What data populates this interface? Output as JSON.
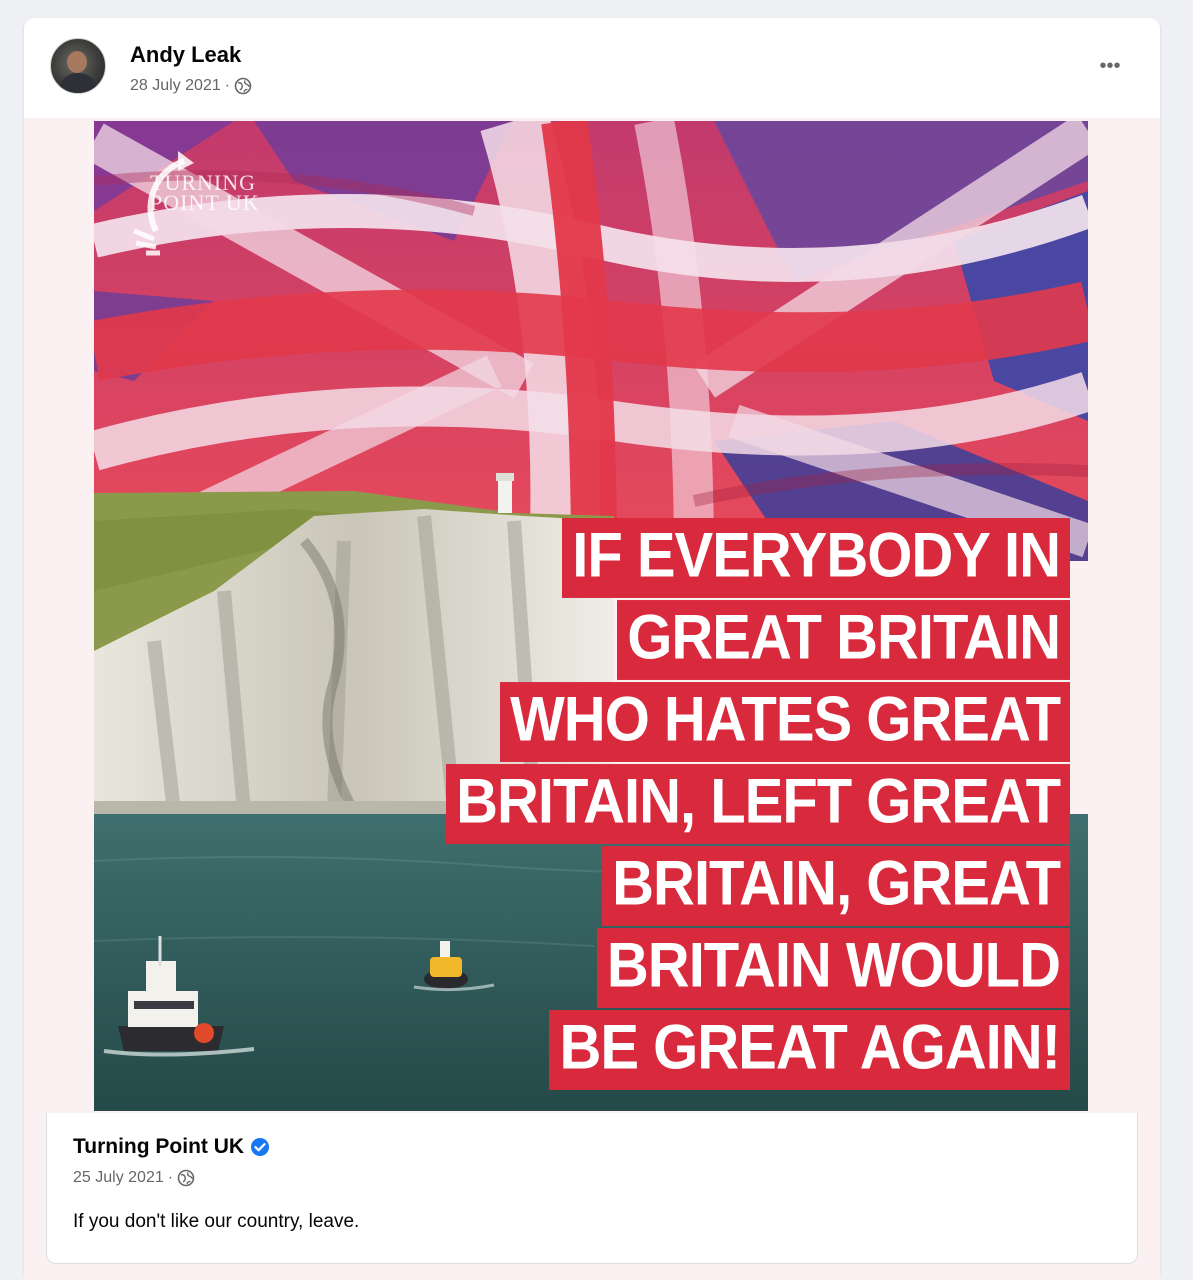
{
  "post": {
    "author": "Andy Leak",
    "date": "28 July 2021",
    "separator": "·",
    "privacy_icon": "globe-icon",
    "more_label": "•••"
  },
  "shared_post": {
    "author": "Turning Point UK",
    "verified_icon": "verified-badge-icon",
    "date": "25 July 2021",
    "separator": "·",
    "privacy_icon": "globe-icon",
    "caption": "If you don't like our country, leave.",
    "image": {
      "logo_lines": [
        "TURNING",
        "POINT UK"
      ],
      "quote_lines": [
        "IF EVERYBODY IN",
        "GREAT BRITAIN",
        "WHO HATES GREAT",
        "BRITAIN, LEFT GREAT",
        "BRITAIN, GREAT",
        "BRITAIN WOULD",
        "BE GREAT AGAIN!"
      ]
    }
  },
  "colors": {
    "quote_bg": "#d82a3c",
    "flag_red": "#e2384a",
    "flag_blue": "#3a3f9a",
    "sea": "#2f5a5a",
    "verified_blue": "#1877f2"
  }
}
